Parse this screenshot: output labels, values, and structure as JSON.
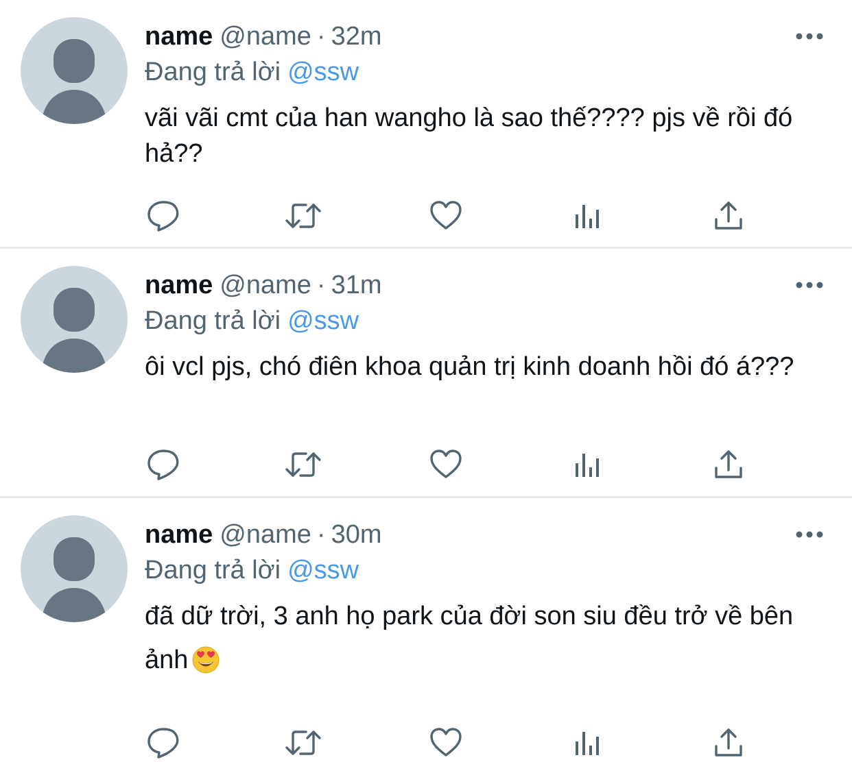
{
  "tweets": [
    {
      "name": "name",
      "handle": "@name",
      "separator": "·",
      "time": "32m",
      "replying_prefix": "Đang trả lời",
      "replying_to": "@ssw",
      "text": "vãi vãi cmt của han wangho là sao thế???? pjs về rồi đó hả??",
      "emoji": ""
    },
    {
      "name": "name",
      "handle": "@name",
      "separator": "·",
      "time": "31m",
      "replying_prefix": "Đang trả lời",
      "replying_to": "@ssw",
      "text": "ôi vcl pjs, chó điên khoa quản trị kinh doanh hồi đó á???",
      "emoji": ""
    },
    {
      "name": "name",
      "handle": "@name",
      "separator": "·",
      "time": "30m",
      "replying_prefix": "Đang trả lời",
      "replying_to": "@ssw",
      "text": "đã dữ trời, 3 anh họ park của đời son siu đều trở về bên ảnh",
      "emoji": "heart-eyes-emoji"
    }
  ],
  "icons": {
    "more": "more-horizontal-icon",
    "reply": "reply-bubble-icon",
    "retweet": "retweet-icon",
    "like": "heart-icon",
    "views": "views-bar-chart-icon",
    "share": "share-upload-icon"
  },
  "colors": {
    "name": "#0f1419",
    "secondary": "#536471",
    "mention": "#4a99e9",
    "avatar_bg": "#ccd6dd",
    "avatar_fg": "#687684",
    "divider": "#e6e9ec"
  }
}
